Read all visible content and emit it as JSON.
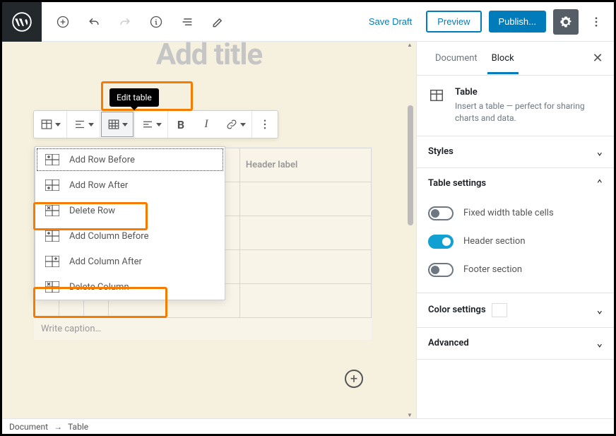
{
  "topbar": {
    "save_draft": "Save Draft",
    "preview": "Preview",
    "publish": "Publish..."
  },
  "tooltip": {
    "edit_table": "Edit table"
  },
  "title_placeholder": "Add title",
  "dropdown": {
    "items": [
      "Add Row Before",
      "Add Row After",
      "Delete Row",
      "Add Column Before",
      "Add Column After",
      "Delete Column"
    ]
  },
  "table": {
    "headers": [
      "Header label",
      "Header label"
    ],
    "caption_placeholder": "Write caption…"
  },
  "sidebar": {
    "tabs": {
      "document": "Document",
      "block": "Block"
    },
    "block_name": "Table",
    "block_desc": "Insert a table — perfect for sharing charts and data.",
    "panels": {
      "styles": "Styles",
      "table_settings": "Table settings",
      "color_settings": "Color settings",
      "advanced": "Advanced"
    },
    "toggles": {
      "fixed_width": "Fixed width table cells",
      "header_section": "Header section",
      "footer_section": "Footer section"
    }
  },
  "breadcrumb": {
    "root": "Document",
    "arrow": "→",
    "current": "Table"
  }
}
